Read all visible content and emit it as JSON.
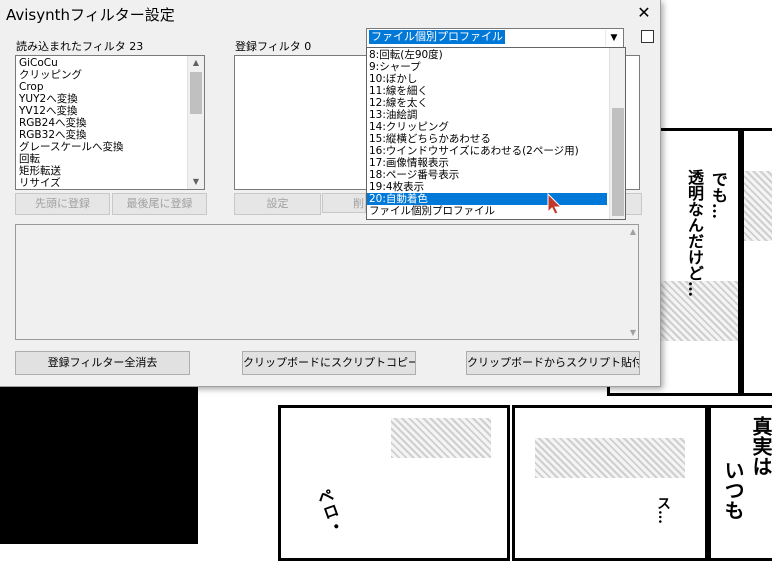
{
  "window": {
    "title": "Avisynthフィルター設定",
    "close_glyph": "✕"
  },
  "loaded_filters": {
    "label": "読み込まれたフィルタ 23",
    "items": [
      "GiCoCu",
      "クリッピング",
      "Crop",
      "YUY2へ変換",
      "YV12へ変換",
      "RGB24へ変換",
      "RGB32へ変換",
      "グレースケールへ変換",
      "回転",
      "矩形転送",
      "リサイズ"
    ]
  },
  "registered_filters": {
    "label": "登録フィルタ 0"
  },
  "buttons": {
    "register_first": "先頭に登録",
    "register_last": "最後尾に登録",
    "settings": "設定",
    "delete_partial": "削",
    "clear_all": "登録フィルター全消去",
    "copy_script": "クリップボードにスクリプトコピー",
    "paste_script": "クリップボードからスクリプト貼付"
  },
  "profile_combo": {
    "value": "ファイル個別プロファイル",
    "options": [
      "8:回転(左90度)",
      "9:シャープ",
      "10:ぼかし",
      "11:線を細く",
      "12:線を太く",
      "13:油絵調",
      "14:クリッピング",
      "15:縦横どちらかあわせる",
      "16:ウインドウサイズにあわせる(2ページ用)",
      "17:画像情報表示",
      "18:ページ番号表示",
      "19:4枚表示",
      "20:自動着色",
      "ファイル個別プロファイル"
    ],
    "highlighted": "20:自動着色"
  },
  "scroll_glyphs": {
    "up": "▲",
    "down": "▼",
    "dropdown": "▼"
  },
  "manga": {
    "text1": "でも…",
    "text2": "透明なんだけど…",
    "text3": "真実は",
    "text4": "いつも",
    "text5": "ペロ・",
    "text6": "ス…"
  },
  "colors": {
    "selection": "#0078d7",
    "dialog_bg": "#f0f0f0"
  }
}
